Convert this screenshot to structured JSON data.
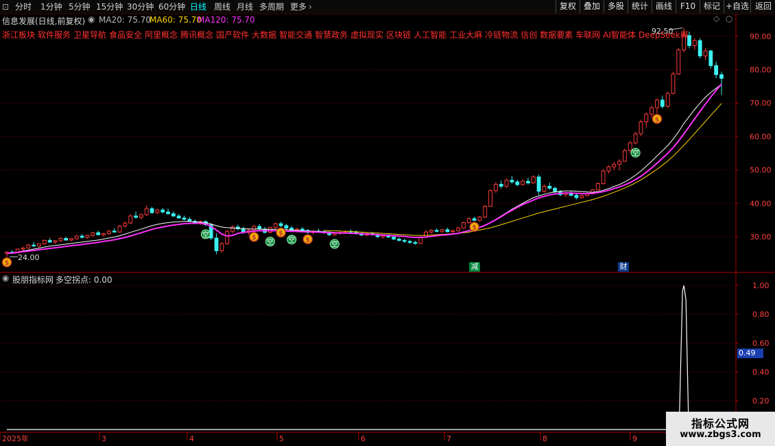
{
  "topbar": {
    "expand_glyph": "⊡",
    "periods": [
      "分时",
      "1分钟",
      "5分钟",
      "15分钟",
      "30分钟",
      "60分钟",
      "日线",
      "周线",
      "月线",
      "多周期",
      "更多"
    ],
    "active_period": "日线",
    "more_chevron": "›",
    "right_buttons": [
      "复权",
      "叠加",
      "多股",
      "统计",
      "画线",
      "F10",
      "标记",
      "+自选",
      "返回"
    ]
  },
  "main_panel": {
    "title": "信息发展(日线,前复权)",
    "ma20": "MA20: 75.70",
    "ma60": "MA60: 75.70",
    "ma120": "MA120: 75.70",
    "concepts": [
      "浙江板块",
      "软件服务",
      "卫星导航",
      "食品安全",
      "阿里概念",
      "腾讯概念",
      "国产软件",
      "大数据",
      "智能交通",
      "智慧政务",
      "虚拟现实",
      "区块链",
      "人工智能",
      "工业大麻",
      "冷链物流",
      "信创",
      "数据要素",
      "车联网",
      "AI智能体",
      "DeepSeek概念"
    ],
    "high_label": "92.50",
    "low_label": "24.00",
    "marker_jian": "减",
    "marker_cai": "财",
    "y_ticks": [
      "90.00",
      "80.00",
      "70.00",
      "60.00",
      "50.00",
      "40.00",
      "30.00"
    ]
  },
  "indicator_panel": {
    "title": "股朋指标网",
    "series_label": "多空拐点: 0.00",
    "current_value": "0.49",
    "y_ticks": [
      "1.00",
      "0.80",
      "0.60",
      "0.40",
      "0.20"
    ]
  },
  "time_axis": {
    "labels": [
      "2025年",
      "3",
      "4",
      "5",
      "6",
      "7",
      "8",
      "9"
    ]
  },
  "signal_labels": {
    "kong": "空",
    "money": "$"
  },
  "watermark": {
    "line1": "指标公式网",
    "line2": "www.zbgs3.com"
  },
  "colors": {
    "up": "#ff3c3c",
    "down": "#3cf0f0",
    "ma20": "#ffffff",
    "ma60": "#ffd700",
    "ma120": "#ff30ff",
    "grid": "#8b0000",
    "active": "#00ffff"
  },
  "chart_data": {
    "type": "candlestick",
    "price_ylim": [
      22,
      95
    ],
    "indicator_ylim": [
      0,
      1.05
    ],
    "candles": [
      [
        25.0,
        25.6,
        24.0,
        25.4
      ],
      [
        25.4,
        26.0,
        25.0,
        25.2
      ],
      [
        25.2,
        26.5,
        25.0,
        26.3
      ],
      [
        26.3,
        27.0,
        25.8,
        26.6
      ],
      [
        26.6,
        27.8,
        26.4,
        27.5
      ],
      [
        27.5,
        28.4,
        27.0,
        27.2
      ],
      [
        27.2,
        28.0,
        26.8,
        27.9
      ],
      [
        27.9,
        29.2,
        27.6,
        28.9
      ],
      [
        28.9,
        29.6,
        28.2,
        28.4
      ],
      [
        28.4,
        29.0,
        27.9,
        28.8
      ],
      [
        28.8,
        29.8,
        28.5,
        29.5
      ],
      [
        29.5,
        30.0,
        28.8,
        29.0
      ],
      [
        29.0,
        29.6,
        28.6,
        29.4
      ],
      [
        29.4,
        30.5,
        29.1,
        30.2
      ],
      [
        30.2,
        30.8,
        29.5,
        29.8
      ],
      [
        29.8,
        30.6,
        29.4,
        30.4
      ],
      [
        30.4,
        31.5,
        30.0,
        31.2
      ],
      [
        31.2,
        31.8,
        30.4,
        30.6
      ],
      [
        30.6,
        31.2,
        30.0,
        30.9
      ],
      [
        30.9,
        32.0,
        30.6,
        31.7
      ],
      [
        31.7,
        32.5,
        31.2,
        31.4
      ],
      [
        31.4,
        33.5,
        31.2,
        33.2
      ],
      [
        33.2,
        34.5,
        32.8,
        34.1
      ],
      [
        34.1,
        36.8,
        33.8,
        36.2
      ],
      [
        36.2,
        37.5,
        35.4,
        35.8
      ],
      [
        35.8,
        37.0,
        35.2,
        36.6
      ],
      [
        36.6,
        39.4,
        36.2,
        38.4
      ],
      [
        38.4,
        38.9,
        36.9,
        37.2
      ],
      [
        37.2,
        38.3,
        36.8,
        38.0
      ],
      [
        38.0,
        38.6,
        37.0,
        37.4
      ],
      [
        37.4,
        38.4,
        36.6,
        36.9
      ],
      [
        36.9,
        37.6,
        35.9,
        36.2
      ],
      [
        36.2,
        36.8,
        35.4,
        35.6
      ],
      [
        35.6,
        36.3,
        34.9,
        35.2
      ],
      [
        35.2,
        35.9,
        34.4,
        34.6
      ],
      [
        34.6,
        35.2,
        33.9,
        34.2
      ],
      [
        34.2,
        34.9,
        33.6,
        34.5
      ],
      [
        34.5,
        35.0,
        33.2,
        33.6
      ],
      [
        33.6,
        34.0,
        29.0,
        29.6
      ],
      [
        29.6,
        31.0,
        24.8,
        25.8
      ],
      [
        25.8,
        28.4,
        25.2,
        27.9
      ],
      [
        27.9,
        32.0,
        27.6,
        31.6
      ],
      [
        31.6,
        33.4,
        30.9,
        32.9
      ],
      [
        32.9,
        33.6,
        31.9,
        32.4
      ],
      [
        32.4,
        33.0,
        30.9,
        31.3
      ],
      [
        31.3,
        32.4,
        30.6,
        31.9
      ],
      [
        31.9,
        33.5,
        31.6,
        33.1
      ],
      [
        33.1,
        33.8,
        31.9,
        32.3
      ],
      [
        32.3,
        32.9,
        30.9,
        31.3
      ],
      [
        31.3,
        33.0,
        31.0,
        32.8
      ],
      [
        32.8,
        34.2,
        32.4,
        33.9
      ],
      [
        33.9,
        34.5,
        32.9,
        33.3
      ],
      [
        33.3,
        33.9,
        32.2,
        32.6
      ],
      [
        32.6,
        33.2,
        31.6,
        32.0
      ],
      [
        32.0,
        32.6,
        31.3,
        32.3
      ],
      [
        32.3,
        32.9,
        31.6,
        31.9
      ],
      [
        31.9,
        32.3,
        30.9,
        31.3
      ],
      [
        31.3,
        31.9,
        30.6,
        31.7
      ],
      [
        31.7,
        32.4,
        31.2,
        31.5
      ],
      [
        31.5,
        32.0,
        30.9,
        31.2
      ],
      [
        31.2,
        31.6,
        30.2,
        30.6
      ],
      [
        30.6,
        31.3,
        30.3,
        31.0
      ],
      [
        31.0,
        31.6,
        30.6,
        31.3
      ],
      [
        31.3,
        31.9,
        30.9,
        31.6
      ],
      [
        31.6,
        32.2,
        31.2,
        31.4
      ],
      [
        31.4,
        31.9,
        30.6,
        30.9
      ],
      [
        30.9,
        31.4,
        30.2,
        30.5
      ],
      [
        30.5,
        31.2,
        30.1,
        30.9
      ],
      [
        30.9,
        31.4,
        30.3,
        30.6
      ],
      [
        30.6,
        31.0,
        29.6,
        30.0
      ],
      [
        30.0,
        30.6,
        29.5,
        30.3
      ],
      [
        30.3,
        30.8,
        29.6,
        29.9
      ],
      [
        29.9,
        30.3,
        29.0,
        29.3
      ],
      [
        29.3,
        29.8,
        28.6,
        28.9
      ],
      [
        28.9,
        29.4,
        28.2,
        28.6
      ],
      [
        28.6,
        29.1,
        27.9,
        28.3
      ],
      [
        28.3,
        28.8,
        27.6,
        28.0
      ],
      [
        28.0,
        30.2,
        27.8,
        29.9
      ],
      [
        29.9,
        32.0,
        29.6,
        31.4
      ],
      [
        31.4,
        32.3,
        30.9,
        31.9
      ],
      [
        31.9,
        32.5,
        31.3,
        31.6
      ],
      [
        31.6,
        32.3,
        31.1,
        32.1
      ],
      [
        32.1,
        32.7,
        31.3,
        31.5
      ],
      [
        31.5,
        32.1,
        30.9,
        31.8
      ],
      [
        31.8,
        33.0,
        31.5,
        32.6
      ],
      [
        32.6,
        34.5,
        32.4,
        34.2
      ],
      [
        34.2,
        35.8,
        33.9,
        35.4
      ],
      [
        35.4,
        36.0,
        34.6,
        34.9
      ],
      [
        34.9,
        36.2,
        34.5,
        35.9
      ],
      [
        35.9,
        39.5,
        35.6,
        39.1
      ],
      [
        39.1,
        44.2,
        38.9,
        43.8
      ],
      [
        43.8,
        46.4,
        43.1,
        45.7
      ],
      [
        45.7,
        46.8,
        44.4,
        45.1
      ],
      [
        45.1,
        47.4,
        44.6,
        46.9
      ],
      [
        46.9,
        48.2,
        45.9,
        46.4
      ],
      [
        46.4,
        47.0,
        45.1,
        45.6
      ],
      [
        45.6,
        47.2,
        45.3,
        46.6
      ],
      [
        46.6,
        47.6,
        45.6,
        46.1
      ],
      [
        46.1,
        48.4,
        45.9,
        47.9
      ],
      [
        47.9,
        48.6,
        42.4,
        43.6
      ],
      [
        43.6,
        45.6,
        43.1,
        45.1
      ],
      [
        45.1,
        46.2,
        44.1,
        44.5
      ],
      [
        44.5,
        45.0,
        43.1,
        43.4
      ],
      [
        43.4,
        44.0,
        42.1,
        42.6
      ],
      [
        42.6,
        43.4,
        41.9,
        43.0
      ],
      [
        43.0,
        43.6,
        42.1,
        42.4
      ],
      [
        42.4,
        43.0,
        41.2,
        41.7
      ],
      [
        41.7,
        42.6,
        41.4,
        42.3
      ],
      [
        42.3,
        43.2,
        42.0,
        42.9
      ],
      [
        42.9,
        44.3,
        42.6,
        44.0
      ],
      [
        44.0,
        46.2,
        43.8,
        45.9
      ],
      [
        45.9,
        50.2,
        45.6,
        49.7
      ],
      [
        49.7,
        51.4,
        48.9,
        50.9
      ],
      [
        50.9,
        52.4,
        49.9,
        51.7
      ],
      [
        51.7,
        53.2,
        49.9,
        52.6
      ],
      [
        52.6,
        56.4,
        52.4,
        55.8
      ],
      [
        55.8,
        58.6,
        55.1,
        58.1
      ],
      [
        58.1,
        61.4,
        57.6,
        60.8
      ],
      [
        60.8,
        65.0,
        60.1,
        64.4
      ],
      [
        64.4,
        67.2,
        62.6,
        66.7
      ],
      [
        66.7,
        69.2,
        65.6,
        68.6
      ],
      [
        68.6,
        71.4,
        66.9,
        70.9
      ],
      [
        70.9,
        72.2,
        68.4,
        69.0
      ],
      [
        69.0,
        73.4,
        68.6,
        72.9
      ],
      [
        72.9,
        79.4,
        72.6,
        78.7
      ],
      [
        78.7,
        86.5,
        78.4,
        85.9
      ],
      [
        85.9,
        92.5,
        85.1,
        90.2
      ],
      [
        90.2,
        91.4,
        86.4,
        87.2
      ],
      [
        87.2,
        89.4,
        85.9,
        88.7
      ],
      [
        88.7,
        89.4,
        83.4,
        84.1
      ],
      [
        84.1,
        86.4,
        82.9,
        85.6
      ],
      [
        85.6,
        85.9,
        80.4,
        81.2
      ],
      [
        81.2,
        82.4,
        77.4,
        78.5
      ],
      [
        78.5,
        79.4,
        72.4,
        77.4
      ]
    ],
    "ma20": [
      25.0,
      25.2,
      25.4,
      25.7,
      26.0,
      26.3,
      26.6,
      26.9,
      27.2,
      27.4,
      27.6,
      27.8,
      28.0,
      28.2,
      28.4,
      28.6,
      28.8,
      29.0,
      29.3,
      29.6,
      29.9,
      30.3,
      30.8,
      31.3,
      31.8,
      32.3,
      32.8,
      33.3,
      33.7,
      34.0,
      34.2,
      34.4,
      34.5,
      34.6,
      34.6,
      34.5,
      34.4,
      34.2,
      33.8,
      33.3,
      32.9,
      32.7,
      32.6,
      32.5,
      32.4,
      32.3,
      32.3,
      32.3,
      32.2,
      32.2,
      32.2,
      32.2,
      32.1,
      32.0,
      31.9,
      31.8,
      31.7,
      31.6,
      31.6,
      31.5,
      31.4,
      31.3,
      31.2,
      31.2,
      31.1,
      31.1,
      31.0,
      30.9,
      30.8,
      30.7,
      30.6,
      30.5,
      30.4,
      30.3,
      30.1,
      29.9,
      29.8,
      29.8,
      29.9,
      30.1,
      30.3,
      30.5,
      30.7,
      30.9,
      31.1,
      31.5,
      31.9,
      32.4,
      32.9,
      33.5,
      34.3,
      35.2,
      36.2,
      37.2,
      38.2,
      39.1,
      40.0,
      40.9,
      41.7,
      42.2,
      42.7,
      43.1,
      43.4,
      43.6,
      43.7,
      43.7,
      43.6,
      43.5,
      43.4,
      43.3,
      43.5,
      43.9,
      44.4,
      45.0,
      45.6,
      46.4,
      47.3,
      48.4,
      49.7,
      51.1,
      52.6,
      54.2,
      55.7,
      57.3,
      59.2,
      61.4,
      63.9,
      66.0,
      68.1,
      70.0,
      71.7,
      73.2,
      74.4,
      75.7
    ],
    "ma60": [
      null,
      null,
      null,
      null,
      null,
      null,
      null,
      null,
      null,
      null,
      null,
      null,
      null,
      null,
      null,
      null,
      null,
      null,
      null,
      null,
      null,
      null,
      null,
      null,
      null,
      null,
      null,
      null,
      null,
      null,
      null,
      null,
      null,
      null,
      null,
      null,
      null,
      null,
      null,
      null,
      null,
      null,
      null,
      null,
      null,
      null,
      null,
      null,
      null,
      null,
      null,
      null,
      null,
      null,
      null,
      null,
      null,
      null,
      null,
      31.9,
      31.8,
      31.8,
      31.7,
      31.6,
      31.6,
      31.5,
      31.4,
      31.3,
      31.2,
      31.1,
      31.0,
      30.9,
      30.8,
      30.7,
      30.6,
      30.5,
      30.4,
      30.4,
      30.4,
      30.5,
      30.6,
      30.7,
      30.8,
      30.9,
      31.0,
      31.2,
      31.4,
      31.7,
      32.0,
      32.3,
      32.7,
      33.1,
      33.6,
      34.1,
      34.6,
      35.1,
      35.6,
      36.1,
      36.6,
      37.1,
      37.5,
      37.9,
      38.3,
      38.7,
      39.1,
      39.5,
      39.9,
      40.3,
      40.7,
      41.1,
      41.6,
      42.1,
      42.7,
      43.3,
      43.9,
      44.6,
      45.3,
      46.1,
      47.0,
      48.0,
      49.1,
      50.2,
      51.4,
      52.7,
      54.1,
      55.7,
      57.4,
      59.1,
      60.9,
      62.7,
      64.5,
      66.3,
      68.1,
      69.9
    ],
    "ma120": [
      25.0,
      25.1,
      25.3,
      25.5,
      25.7,
      25.9,
      26.1,
      26.3,
      26.5,
      26.7,
      26.9,
      27.1,
      27.3,
      27.5,
      27.7,
      27.9,
      28.1,
      28.3,
      28.6,
      28.8,
      29.1,
      29.4,
      29.8,
      30.2,
      30.7,
      31.2,
      31.7,
      32.2,
      32.6,
      32.9,
      33.2,
      33.5,
      33.7,
      33.9,
      34.0,
      34.0,
      34.0,
      33.8,
      33.1,
      32.0,
      30.8,
      30.2,
      30.4,
      31.0,
      31.3,
      31.5,
      31.7,
      31.8,
      31.8,
      31.8,
      31.8,
      31.8,
      31.7,
      31.6,
      31.6,
      31.5,
      31.5,
      31.4,
      31.4,
      31.3,
      31.2,
      31.2,
      31.1,
      31.1,
      31.0,
      31.0,
      30.9,
      30.8,
      30.7,
      30.6,
      30.5,
      30.4,
      30.3,
      30.2,
      30.1,
      29.9,
      29.8,
      29.8,
      29.9,
      30.1,
      30.3,
      30.5,
      30.6,
      30.8,
      31.0,
      31.4,
      31.8,
      32.3,
      32.8,
      33.4,
      34.2,
      35.1,
      36.0,
      37.0,
      37.9,
      38.8,
      39.6,
      40.3,
      41.0,
      41.6,
      42.1,
      42.5,
      42.8,
      43.0,
      43.1,
      43.1,
      43.0,
      42.9,
      42.9,
      43.0,
      43.2,
      43.5,
      43.9,
      44.4,
      44.9,
      45.5,
      46.2,
      47.1,
      48.1,
      49.3,
      50.6,
      52.0,
      53.5,
      55.0,
      56.7,
      58.6,
      60.8,
      63.0,
      65.3,
      67.5,
      69.7,
      71.8,
      73.8,
      75.7
    ],
    "indicator": {
      "spike_index": 126,
      "spike_value": 1.0,
      "baseline": 0.0,
      "last_value": 0.49
    },
    "signals": [
      {
        "type": "kong",
        "index": 37
      },
      {
        "type": "kong",
        "index": 49
      },
      {
        "type": "kong",
        "index": 53
      },
      {
        "type": "kong",
        "index": 61
      },
      {
        "type": "kong",
        "index": 117
      },
      {
        "type": "money",
        "index": 0
      },
      {
        "type": "money",
        "index": 46
      },
      {
        "type": "money",
        "index": 51
      },
      {
        "type": "money",
        "index": 56
      },
      {
        "type": "money",
        "index": 87
      },
      {
        "type": "money",
        "index": 121
      }
    ]
  }
}
